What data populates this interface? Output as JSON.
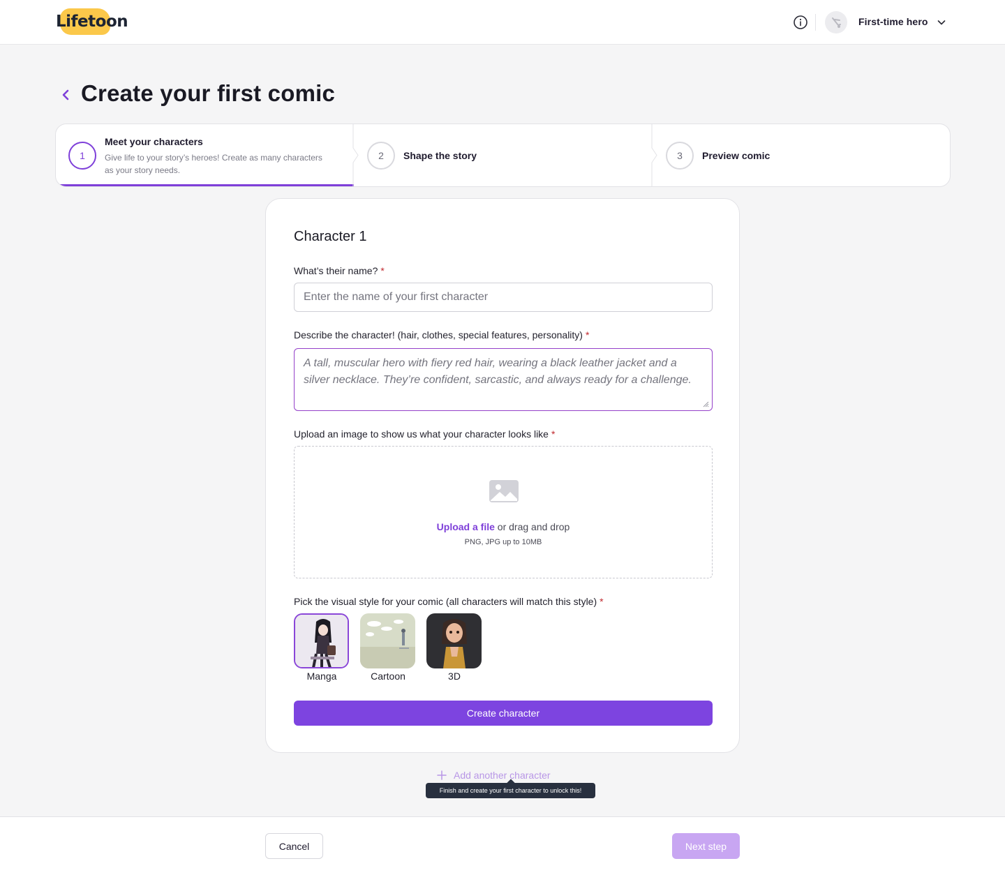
{
  "header": {
    "brand": "Lifetoon",
    "user_name": "First-time hero",
    "icons": [
      "info-icon",
      "avatar",
      "chevron-down-icon"
    ]
  },
  "page": {
    "title": "Create your first comic"
  },
  "stepper": {
    "steps": [
      {
        "number": "1",
        "title": "Meet your characters",
        "description": "Give life to your story’s heroes! Create as many characters as your story needs."
      },
      {
        "number": "2",
        "title": "Shape the story"
      },
      {
        "number": "3",
        "title": "Preview comic"
      }
    ],
    "active_index": 0
  },
  "form": {
    "card_title": "Character 1",
    "name_label": "What’s their name?",
    "name_placeholder": "Enter the name of your first character",
    "name_value": "",
    "desc_label": "Describe the character! (hair, clothes, special features, personality)",
    "desc_placeholder": "A tall, muscular hero with fiery red hair, wearing a black leather jacket and a silver necklace. They’re confident, sarcastic, and always ready for a challenge.",
    "upload_label": "Upload an image to show us what your character looks like",
    "upload_link": "Upload a file",
    "upload_text": "or drag and drop",
    "upload_hint": "PNG, JPG up to 10MB",
    "style_label": "Pick the visual style for your comic (all characters will match this style)",
    "required_mark": "*",
    "styles": [
      {
        "label": "Manga",
        "selected": true
      },
      {
        "label": "Cartoon",
        "selected": false
      },
      {
        "label": "3D",
        "selected": false
      }
    ],
    "create_button": "Create character"
  },
  "add_another": {
    "label": "Add another character",
    "tooltip": "Finish and create your first character to unlock this!"
  },
  "footer": {
    "cancel": "Cancel",
    "next": "Next step"
  },
  "colors": {
    "accent": "#7d44e0",
    "accent_disabled": "#c8a6f2",
    "logo_yellow": "#fbc84a",
    "required": "#c0292e"
  }
}
